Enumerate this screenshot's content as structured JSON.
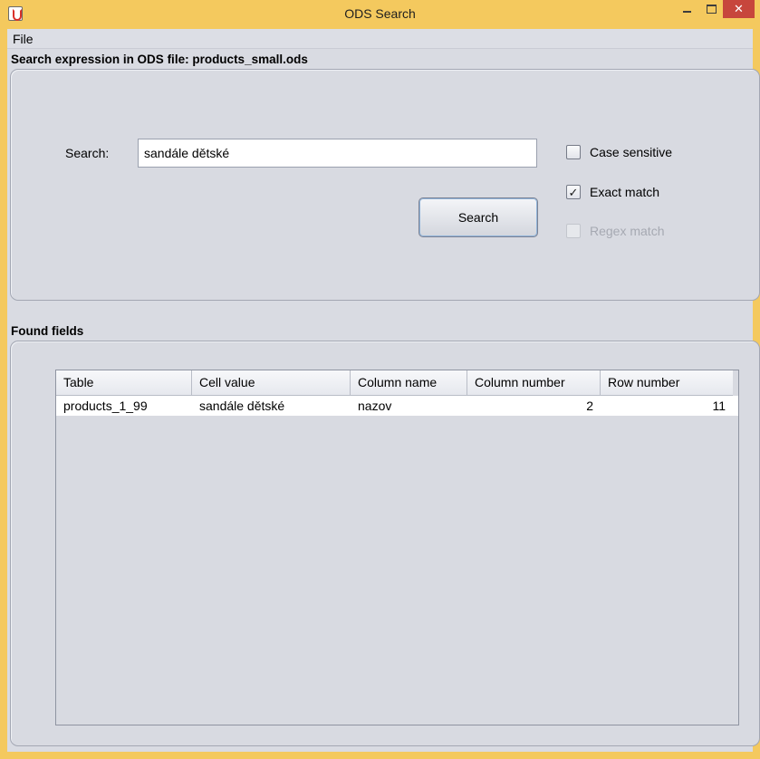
{
  "window": {
    "title": "ODS Search",
    "icon": "java-icon"
  },
  "menu": {
    "items": [
      "File"
    ]
  },
  "search_section": {
    "title": "Search expression in ODS file: products_small.ods",
    "label": "Search:",
    "value": "sandále dětské",
    "button_label": "Search",
    "options": [
      {
        "label": "Case sensitive",
        "checked": false,
        "enabled": true
      },
      {
        "label": "Exact match",
        "checked": true,
        "enabled": true
      },
      {
        "label": "Regex match",
        "checked": false,
        "enabled": false
      }
    ]
  },
  "results_section": {
    "title": "Found fields",
    "columns": [
      "Table",
      "Cell value",
      "Column name",
      "Column number",
      "Row number"
    ],
    "rows": [
      [
        "products_1_99",
        "sandále dětské",
        "nazov",
        "2",
        "11"
      ]
    ]
  },
  "colors": {
    "frame": "#f4c95e",
    "client": "#d9dbe2",
    "close_button": "#c7463c"
  }
}
